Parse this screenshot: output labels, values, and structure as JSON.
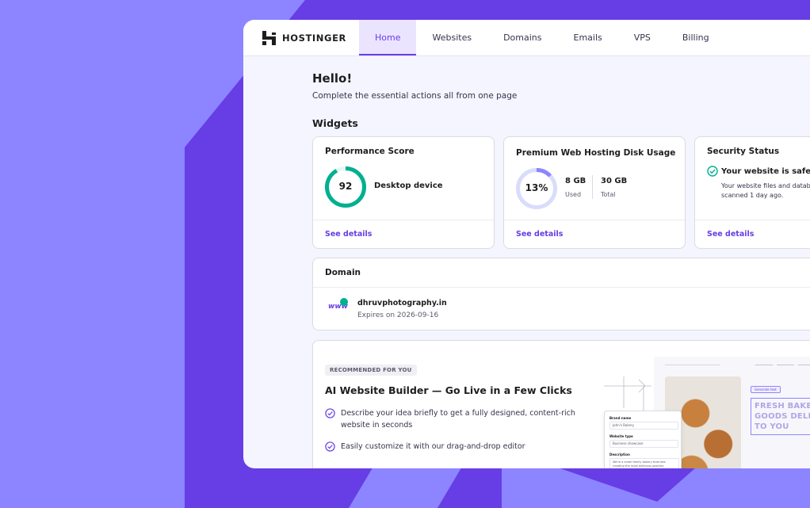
{
  "brand": {
    "name": "HOSTINGER"
  },
  "nav": {
    "tabs": [
      {
        "label": "Home",
        "active": true
      },
      {
        "label": "Websites"
      },
      {
        "label": "Domains"
      },
      {
        "label": "Emails"
      },
      {
        "label": "VPS"
      },
      {
        "label": "Billing"
      }
    ]
  },
  "page": {
    "greeting": "Hello!",
    "subtitle": "Complete the essential actions all from one page",
    "widgets_title": "Widgets"
  },
  "performance": {
    "title": "Performance Score",
    "score": "92",
    "score_fraction": 0.92,
    "device": "Desktop device",
    "link": "See details"
  },
  "disk": {
    "title": "Premium Web Hosting Disk Usage",
    "percent_label": "13%",
    "percent": 0.13,
    "used_value": "8 GB",
    "used_label": "Used",
    "total_value": "30 GB",
    "total_label": "Total",
    "link": "See details"
  },
  "security": {
    "title": "Security Status",
    "status": "Your website is safe",
    "detail_line1": "Your website files and databas",
    "detail_line2": "scanned 1 day ago.",
    "link": "See details"
  },
  "domain": {
    "title": "Domain",
    "name": "dhruvphotography.in",
    "expires": "Expires on 2026-09-16",
    "icon_text": "www"
  },
  "recommendation": {
    "badge": "RECOMMENDED FOR YOU",
    "title": "AI Website Builder — Go Live in a Few Clicks",
    "item1": "Describe your idea briefly to get a fully designed, content-rich website in seconds",
    "item2": "Easily customize it with our drag-and-drop editor",
    "preview": {
      "form_label1": "Brand name",
      "form_value1": "John's Bakery",
      "form_label2": "Website type",
      "form_value2": "Business showcase",
      "form_label3": "Description",
      "form_value3": "We're a small family bakery business creating the most delicious pastries",
      "tag": "Generate text",
      "headline_line1": "FRESH BAKED",
      "headline_line2": "GOODS DELIVERE",
      "headline_line3": "TO YOU"
    }
  },
  "colors": {
    "accent": "#673de6",
    "success": "#00b090",
    "background": "#8c85ff",
    "panel": "#f4f5ff"
  }
}
